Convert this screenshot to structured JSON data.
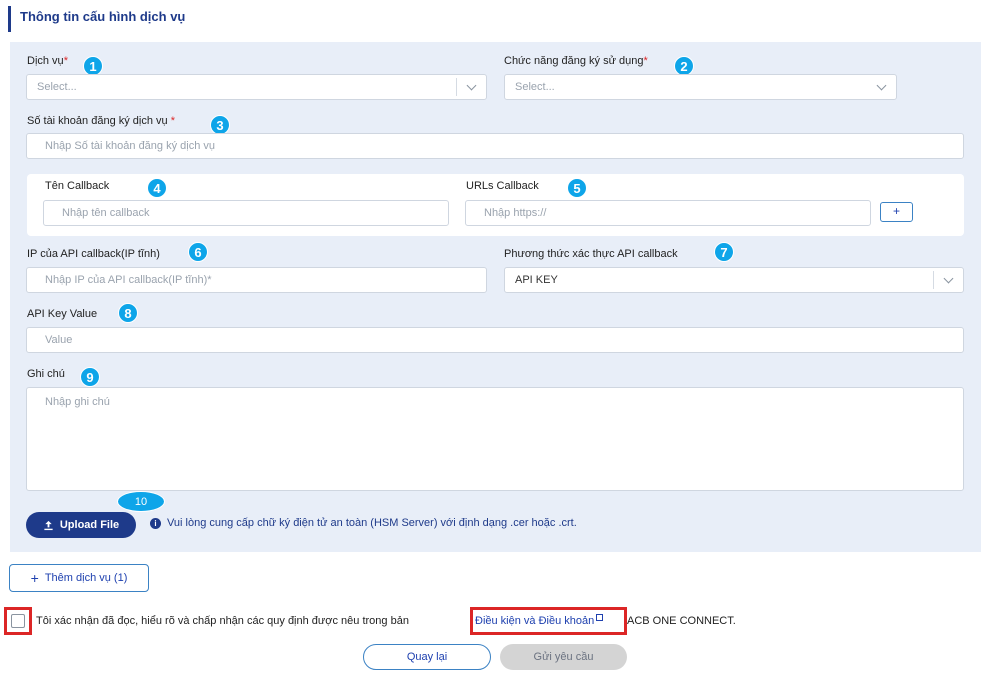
{
  "section_title": "Thông tin cấu hình dịch vụ",
  "fields": {
    "service": {
      "label": "Dịch vụ",
      "required": "*",
      "placeholder": "Select...",
      "badge": "1"
    },
    "function": {
      "label": "Chức năng đăng ký sử dụng",
      "required": "*",
      "placeholder": "Select...",
      "badge": "2"
    },
    "account": {
      "label": "Số tài khoản đăng ký dịch vụ",
      "required": "*",
      "placeholder": "Nhập Số tài khoản đăng ký dịch vụ",
      "badge": "3"
    },
    "callback_name": {
      "label": "Tên Callback",
      "placeholder": "Nhập tên callback",
      "badge": "4"
    },
    "callback_url": {
      "label": "URLs Callback",
      "placeholder": "Nhập https://",
      "badge": "5",
      "add_label": "+"
    },
    "api_ip": {
      "label": "IP của API callback(IP tĩnh)",
      "placeholder": "Nhập IP của API callback(IP tĩnh)*",
      "badge": "6"
    },
    "auth_method": {
      "label": "Phương thức xác thực API callback",
      "value": "API KEY",
      "badge": "7"
    },
    "api_key": {
      "label": "API Key Value",
      "placeholder": "Value",
      "badge": "8"
    },
    "note": {
      "label": "Ghi chú",
      "placeholder": "Nhập ghi chú",
      "badge": "9"
    }
  },
  "upload": {
    "label": "Upload File",
    "badge": "10",
    "info": "Vui lòng cung cấp chữ ký điện tử an toàn (HSM Server) với định dạng .cer hoặc .crt."
  },
  "add_service_label": "Thêm dịch vụ (1)",
  "confirm": {
    "text_before": "Tôi xác nhận đã đọc, hiểu rõ và chấp nhận các quy định được nêu trong bản",
    "terms_link": "Điều kiện và Điều khoản",
    "text_after": "ACB ONE CONNECT."
  },
  "actions": {
    "back_label": "Quay lại",
    "submit_label": "Gửi yêu cầu"
  },
  "colors": {
    "primary": "#1e3a8a",
    "badge": "#0ea5e9",
    "highlight": "#dc2626",
    "panel_bg": "#e8eef8"
  }
}
